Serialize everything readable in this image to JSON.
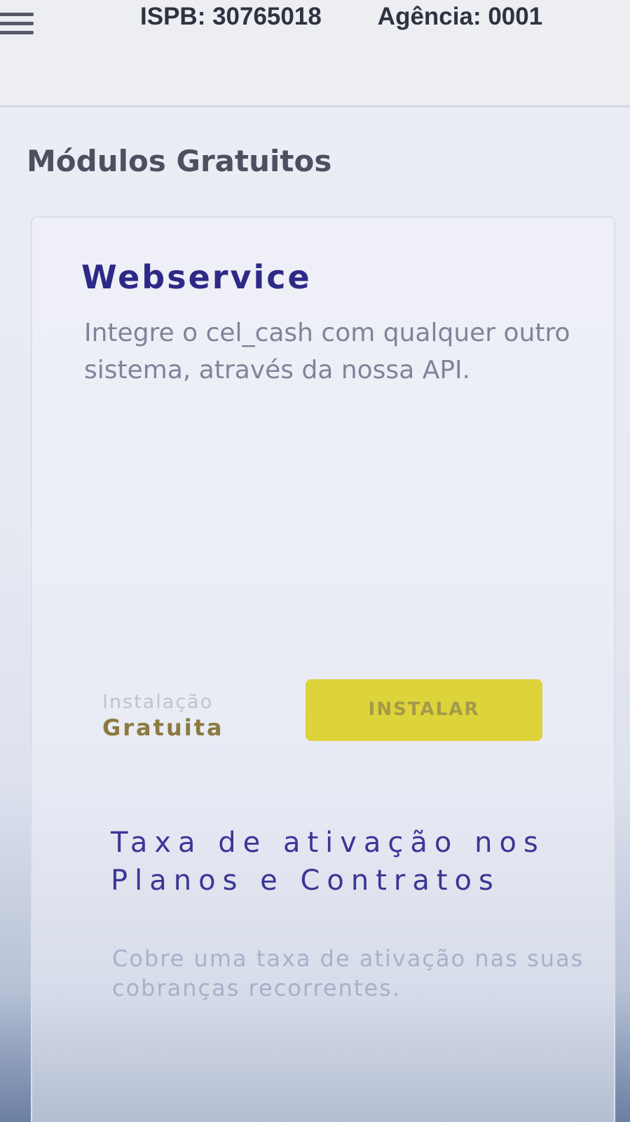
{
  "header": {
    "menu_icon": "hamburger-menu-icon",
    "ispb": "ISPB: 30765018",
    "agencia": "Agência: 0001"
  },
  "section": {
    "title": "Módulos Gratuitos"
  },
  "modules": [
    {
      "title": "Webservice",
      "description": "Integre o cel_cash com qualquer outro sistema, através da nossa API.",
      "install_label": "Instalação",
      "install_price": "Gratuita",
      "install_button": "INSTALAR"
    },
    {
      "title": "Taxa de ativação nos Planos e Contratos",
      "description": "Cobre uma taxa de ativação nas suas cobranças recorrentes."
    }
  ],
  "colors": {
    "accent": "#2d2a86",
    "button": "#ddd33a",
    "price": "#8c7a3f"
  }
}
